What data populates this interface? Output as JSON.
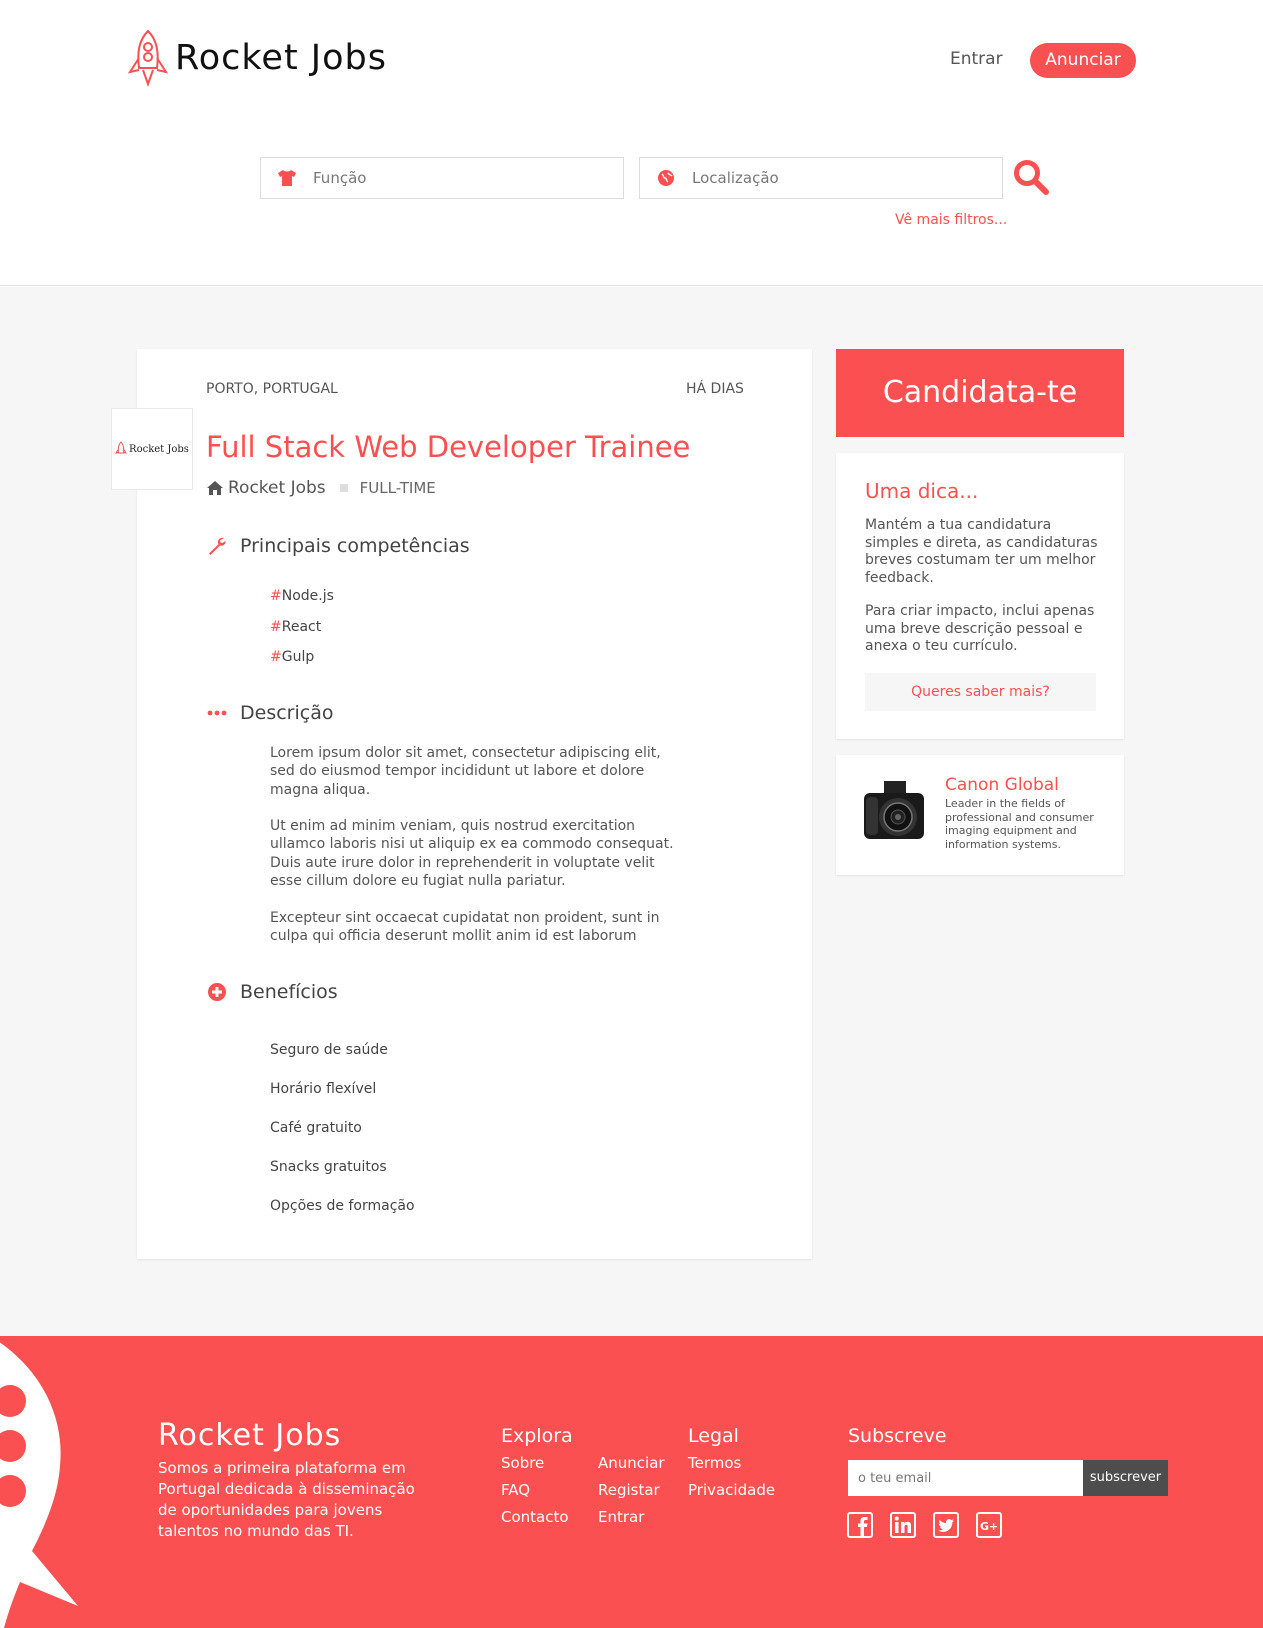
{
  "header": {
    "brand": "Rocket Jobs",
    "login": "Entrar",
    "post_job": "Anunciar",
    "search": {
      "role_placeholder": "Função",
      "location_placeholder": "Localização",
      "more_filters": "Vê mais filtros..."
    }
  },
  "job": {
    "location": "PORTO, PORTUGAL",
    "posted": "HÁ DIAS",
    "company_logo_text": "Rocket Jobs",
    "title": "Full Stack Web Developer Trainee",
    "company": "Rocket Jobs",
    "type": "FULL-TIME",
    "skills_title": "Principais competências",
    "skills": [
      "Node.js",
      "React",
      "Gulp"
    ],
    "skill_prefix": "#",
    "description_title": "Descrição",
    "description": [
      "Lorem ipsum dolor sit amet, consectetur adipiscing elit, sed do eiusmod tempor incididunt ut labore et dolore magna aliqua.",
      "Ut enim ad minim veniam, quis nostrud exercitation ullamco laboris nisi ut aliquip ex ea commodo consequat. Duis aute irure dolor in reprehenderit in voluptate velit esse cillum dolore eu fugiat nulla pariatur.",
      "Excepteur sint occaecat cupidatat non proident, sunt in culpa qui officia deserunt mollit anim id est laborum"
    ],
    "benefits_title": "Benefícios",
    "benefits": [
      "Seguro de saúde",
      "Horário flexível",
      "Café gratuito",
      "Snacks gratuitos",
      "Opções de formação"
    ]
  },
  "sidebar": {
    "apply": "Candidata-te",
    "tip_title": "Uma dica...",
    "tip_p1": "Mantém a tua candidatura simples e direta, as candidaturas breves costumam ter um melhor feedback.",
    "tip_p2": "Para criar impacto, inclui apenas uma breve descrição pessoal e anexa o teu currículo.",
    "tip_more": "Queres saber mais?",
    "ad_title": "Canon Global",
    "ad_text": "Leader in the fields of professional and consumer imaging equipment and information systems."
  },
  "footer": {
    "brand": "Rocket Jobs",
    "about": "Somos a primeira plataforma em Portugal dedicada à disseminação de oportunidades para jovens talentos no mundo das TI.",
    "explore_title": "Explora",
    "explore_links": [
      "Sobre",
      "FAQ",
      "Contacto",
      "Anunciar",
      "Registar",
      "Entrar"
    ],
    "legal_title": "Legal",
    "legal_links": [
      "Termos",
      "Privacidade"
    ],
    "subscribe_title": "Subscreve",
    "email_placeholder": "o teu email",
    "subscribe_button": "subscrever",
    "social_icons": [
      "facebook-icon",
      "linkedin-icon",
      "twitter-icon",
      "google-plus-icon"
    ]
  },
  "colors": {
    "accent": "#fb5051",
    "dark_button": "#4d4d4d",
    "page_bg": "#f6f6f6"
  }
}
